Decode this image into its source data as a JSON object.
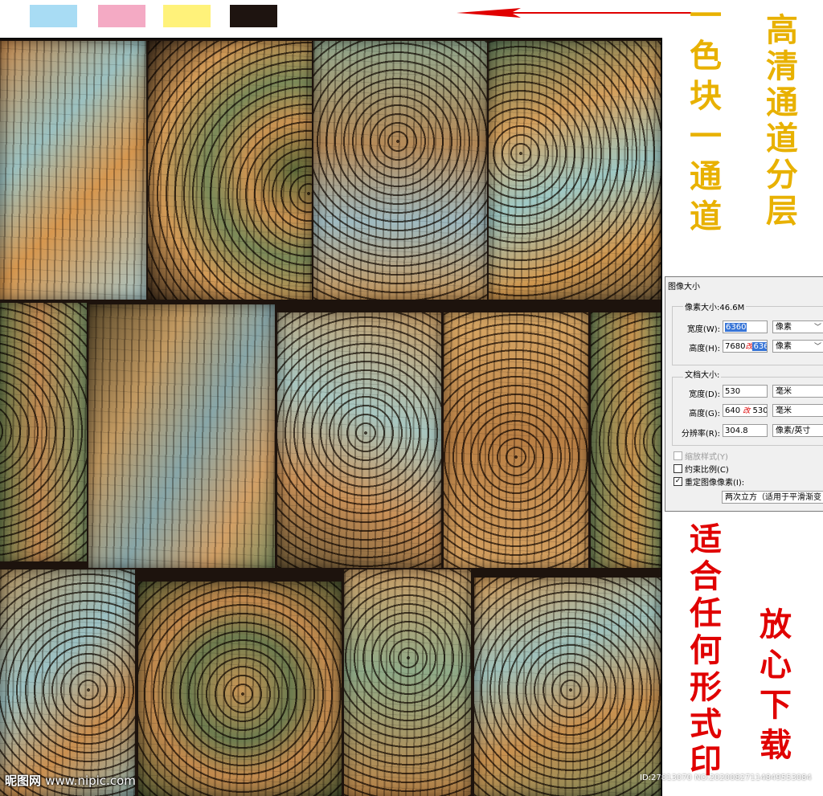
{
  "swatches": [
    {
      "name": "cyan",
      "color": "#a8dcf4"
    },
    {
      "name": "magenta",
      "color": "#f4aac4"
    },
    {
      "name": "yellow",
      "color": "#fff27a"
    },
    {
      "name": "black",
      "color": "#1e1410"
    }
  ],
  "annotations": {
    "channel_text": [
      "一",
      "色",
      "块",
      "一",
      "通",
      "道"
    ],
    "hd_text": [
      "高",
      "清",
      "通",
      "道",
      "分",
      "层"
    ],
    "print_text": [
      "适",
      "合",
      "任",
      "何",
      "形",
      "式",
      "印"
    ],
    "download_text": [
      "放",
      "心",
      "下",
      "载"
    ]
  },
  "dialog": {
    "title": "图像大小",
    "pixel_dimensions_label": "像素大小:46.6M",
    "width_label": "宽度(W):",
    "width_value": "6360",
    "width_unit": "像素",
    "height_label": "高度(H):",
    "height_value_prefix": "7680",
    "height_mark": "改",
    "height_value": "6360",
    "height_unit": "像素",
    "document_size_label": "文档大小:",
    "doc_width_label": "宽度(D):",
    "doc_width_value": "530",
    "doc_width_unit": "毫米",
    "doc_height_label": "高度(G):",
    "doc_height_value_prefix": "640",
    "doc_height_mark": "改",
    "doc_height_value": "530",
    "doc_height_unit": "毫米",
    "resolution_label": "分辨率(R):",
    "resolution_value": "304.8",
    "resolution_unit": "像素/英寸",
    "scale_styles_label": "缩放样式(Y)",
    "constrain_label": "约束比例(C)",
    "resample_label": "重定图像像素(I):",
    "resample_method": "两次立方（适用于平滑渐变"
  },
  "watermark": {
    "logo_text": "昵图网",
    "site": "www.nipic.com",
    "id_text": "ID:27813070 NO:20200827114849553084"
  },
  "colors": {
    "annotation_gold": "#e8b100",
    "annotation_red": "#e00000",
    "arrow_red": "#e00000",
    "selection_blue": "#3875d7"
  }
}
